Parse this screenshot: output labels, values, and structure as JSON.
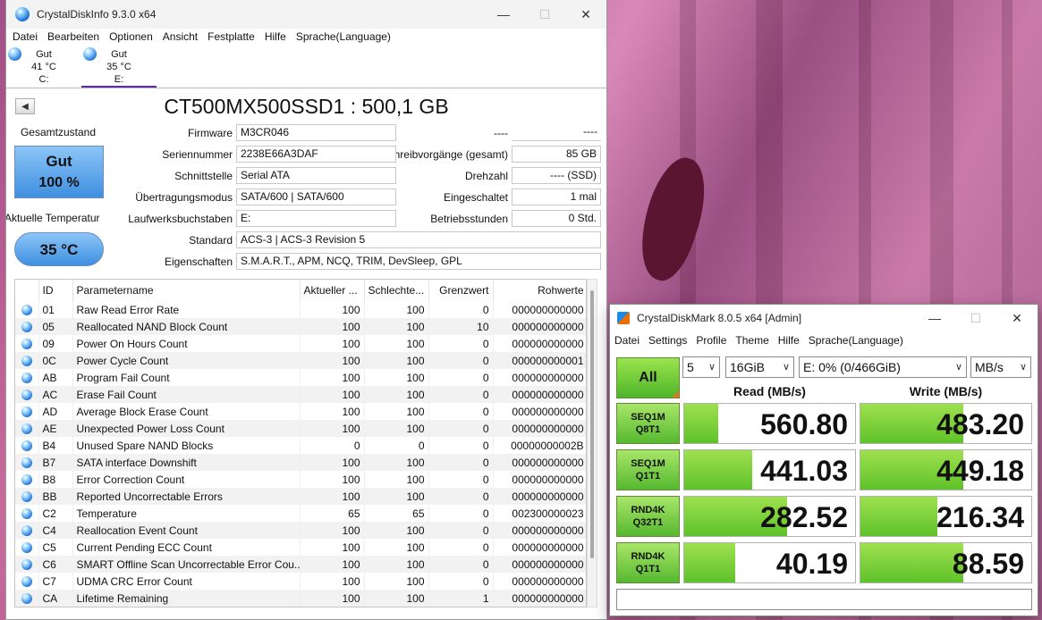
{
  "cdi": {
    "title": "CrystalDiskInfo 9.3.0 x64",
    "menu": [
      "Datei",
      "Bearbeiten",
      "Optionen",
      "Ansicht",
      "Festplatte",
      "Hilfe",
      "Sprache(Language)"
    ],
    "drives": [
      {
        "status": "Gut",
        "temp": "41 °C",
        "letter": "C:"
      },
      {
        "status": "Gut",
        "temp": "35 °C",
        "letter": "E:"
      }
    ],
    "model_title": "CT500MX500SSD1 : 500,1 GB",
    "health_label": "Gesamtzustand",
    "health_status": "Gut",
    "health_percent": "100 %",
    "temp_label": "Aktuelle Temperatur",
    "temp_value": "35 °C",
    "info": {
      "firmware_label": "Firmware",
      "firmware": "M3CR046",
      "serial_label": "Seriennummer",
      "serial": "2238E66A3DAF",
      "interface_label": "Schnittstelle",
      "interface": "Serial ATA",
      "transfer_label": "Übertragungsmodus",
      "transfer": "SATA/600 | SATA/600",
      "letters_label": "Laufwerksbuchstaben",
      "letters": "E:",
      "standard_label": "Standard",
      "standard": "ACS-3 | ACS-3 Revision 5",
      "features_label": "Eigenschaften",
      "features": "S.M.A.R.T., APM, NCQ, TRIM, DevSleep, GPL",
      "r0_label": "----",
      "r0_value": "----",
      "writes_label": "Schreibvorgänge (gesamt)",
      "writes": "85 GB",
      "rpm_label": "Drehzahl",
      "rpm": "---- (SSD)",
      "power_count_label": "Eingeschaltet",
      "power_count": "1 mal",
      "hours_label": "Betriebsstunden",
      "hours": "0 Std."
    },
    "table_headers": [
      "",
      "ID",
      "Parametername",
      "Aktueller ...",
      "Schlechte...",
      "Grenzwert",
      "Rohwerte"
    ],
    "smart_rows": [
      {
        "id": "01",
        "name": "Raw Read Error Rate",
        "cur": "100",
        "worst": "100",
        "thr": "0",
        "raw": "000000000000"
      },
      {
        "id": "05",
        "name": "Reallocated NAND Block Count",
        "cur": "100",
        "worst": "100",
        "thr": "10",
        "raw": "000000000000"
      },
      {
        "id": "09",
        "name": "Power On Hours Count",
        "cur": "100",
        "worst": "100",
        "thr": "0",
        "raw": "000000000000"
      },
      {
        "id": "0C",
        "name": "Power Cycle Count",
        "cur": "100",
        "worst": "100",
        "thr": "0",
        "raw": "000000000001"
      },
      {
        "id": "AB",
        "name": "Program Fail Count",
        "cur": "100",
        "worst": "100",
        "thr": "0",
        "raw": "000000000000"
      },
      {
        "id": "AC",
        "name": "Erase Fail Count",
        "cur": "100",
        "worst": "100",
        "thr": "0",
        "raw": "000000000000"
      },
      {
        "id": "AD",
        "name": "Average Block Erase Count",
        "cur": "100",
        "worst": "100",
        "thr": "0",
        "raw": "000000000000"
      },
      {
        "id": "AE",
        "name": "Unexpected Power Loss Count",
        "cur": "100",
        "worst": "100",
        "thr": "0",
        "raw": "000000000000"
      },
      {
        "id": "B4",
        "name": "Unused Spare NAND Blocks",
        "cur": "0",
        "worst": "0",
        "thr": "0",
        "raw": "00000000002B"
      },
      {
        "id": "B7",
        "name": "SATA interface Downshift",
        "cur": "100",
        "worst": "100",
        "thr": "0",
        "raw": "000000000000"
      },
      {
        "id": "B8",
        "name": "Error Correction Count",
        "cur": "100",
        "worst": "100",
        "thr": "0",
        "raw": "000000000000"
      },
      {
        "id": "BB",
        "name": "Reported Uncorrectable Errors",
        "cur": "100",
        "worst": "100",
        "thr": "0",
        "raw": "000000000000"
      },
      {
        "id": "C2",
        "name": "Temperature",
        "cur": "65",
        "worst": "65",
        "thr": "0",
        "raw": "002300000023"
      },
      {
        "id": "C4",
        "name": "Reallocation Event Count",
        "cur": "100",
        "worst": "100",
        "thr": "0",
        "raw": "000000000000"
      },
      {
        "id": "C5",
        "name": "Current Pending ECC Count",
        "cur": "100",
        "worst": "100",
        "thr": "0",
        "raw": "000000000000"
      },
      {
        "id": "C6",
        "name": "SMART Offline Scan Uncorrectable Error Cou...",
        "cur": "100",
        "worst": "100",
        "thr": "0",
        "raw": "000000000000"
      },
      {
        "id": "C7",
        "name": "UDMA CRC Error Count",
        "cur": "100",
        "worst": "100",
        "thr": "0",
        "raw": "000000000000"
      },
      {
        "id": "CA",
        "name": "Lifetime Remaining",
        "cur": "100",
        "worst": "100",
        "thr": "1",
        "raw": "000000000000"
      }
    ]
  },
  "cdm": {
    "title": "CrystalDiskMark 8.0.5 x64 [Admin]",
    "menu": [
      "Datei",
      "Settings",
      "Profile",
      "Theme",
      "Hilfe",
      "Sprache(Language)"
    ],
    "all_label": "All",
    "count": "5",
    "size": "16GiB",
    "drive": "E: 0% (0/466GiB)",
    "unit": "MB/s",
    "read_header": "Read (MB/s)",
    "write_header": "Write (MB/s)",
    "tests": [
      {
        "l1": "SEQ1M",
        "l2": "Q8T1",
        "read": "560.80",
        "write": "483.20",
        "read_fill": 0.2,
        "write_fill": 0.6
      },
      {
        "l1": "SEQ1M",
        "l2": "Q1T1",
        "read": "441.03",
        "write": "449.18",
        "read_fill": 0.4,
        "write_fill": 0.6
      },
      {
        "l1": "RND4K",
        "l2": "Q32T1",
        "read": "282.52",
        "write": "216.34",
        "read_fill": 0.6,
        "write_fill": 0.45
      },
      {
        "l1": "RND4K",
        "l2": "Q1T1",
        "read": "40.19",
        "write": "88.59",
        "read_fill": 0.3,
        "write_fill": 0.6
      }
    ]
  },
  "colors": {
    "health_blue": "#3e8fe0",
    "bar_green": "#5fc22a",
    "accent_purple": "#5b2ea6"
  }
}
